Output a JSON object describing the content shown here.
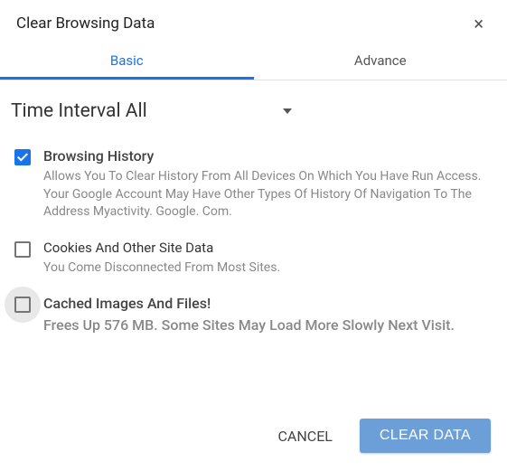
{
  "dialog": {
    "title": "Clear Browsing Data",
    "close_label": "×",
    "tabs": {
      "basic": "Basic",
      "advanced": "Advance"
    },
    "time_interval": {
      "label": "Time Interval All"
    },
    "options": [
      {
        "title": "Browsing History",
        "description": "Allows You To Clear History From All Devices On Which You Have Run Access. Your Google Account May Have Other Types Of History Of Navigation To The Address Myactivity. Google. Com.",
        "checked": true
      },
      {
        "title": "Cookies And Other Site Data",
        "description": "You Come Disconnected From Most Sites.",
        "checked": false
      },
      {
        "title": "Cached Images And Files!",
        "description": "Frees Up 576 MB. Some Sites May Load More Slowly Next Visit.",
        "checked": false
      }
    ],
    "buttons": {
      "cancel": "CANCEL",
      "clear": "CLEAR DATA"
    }
  }
}
